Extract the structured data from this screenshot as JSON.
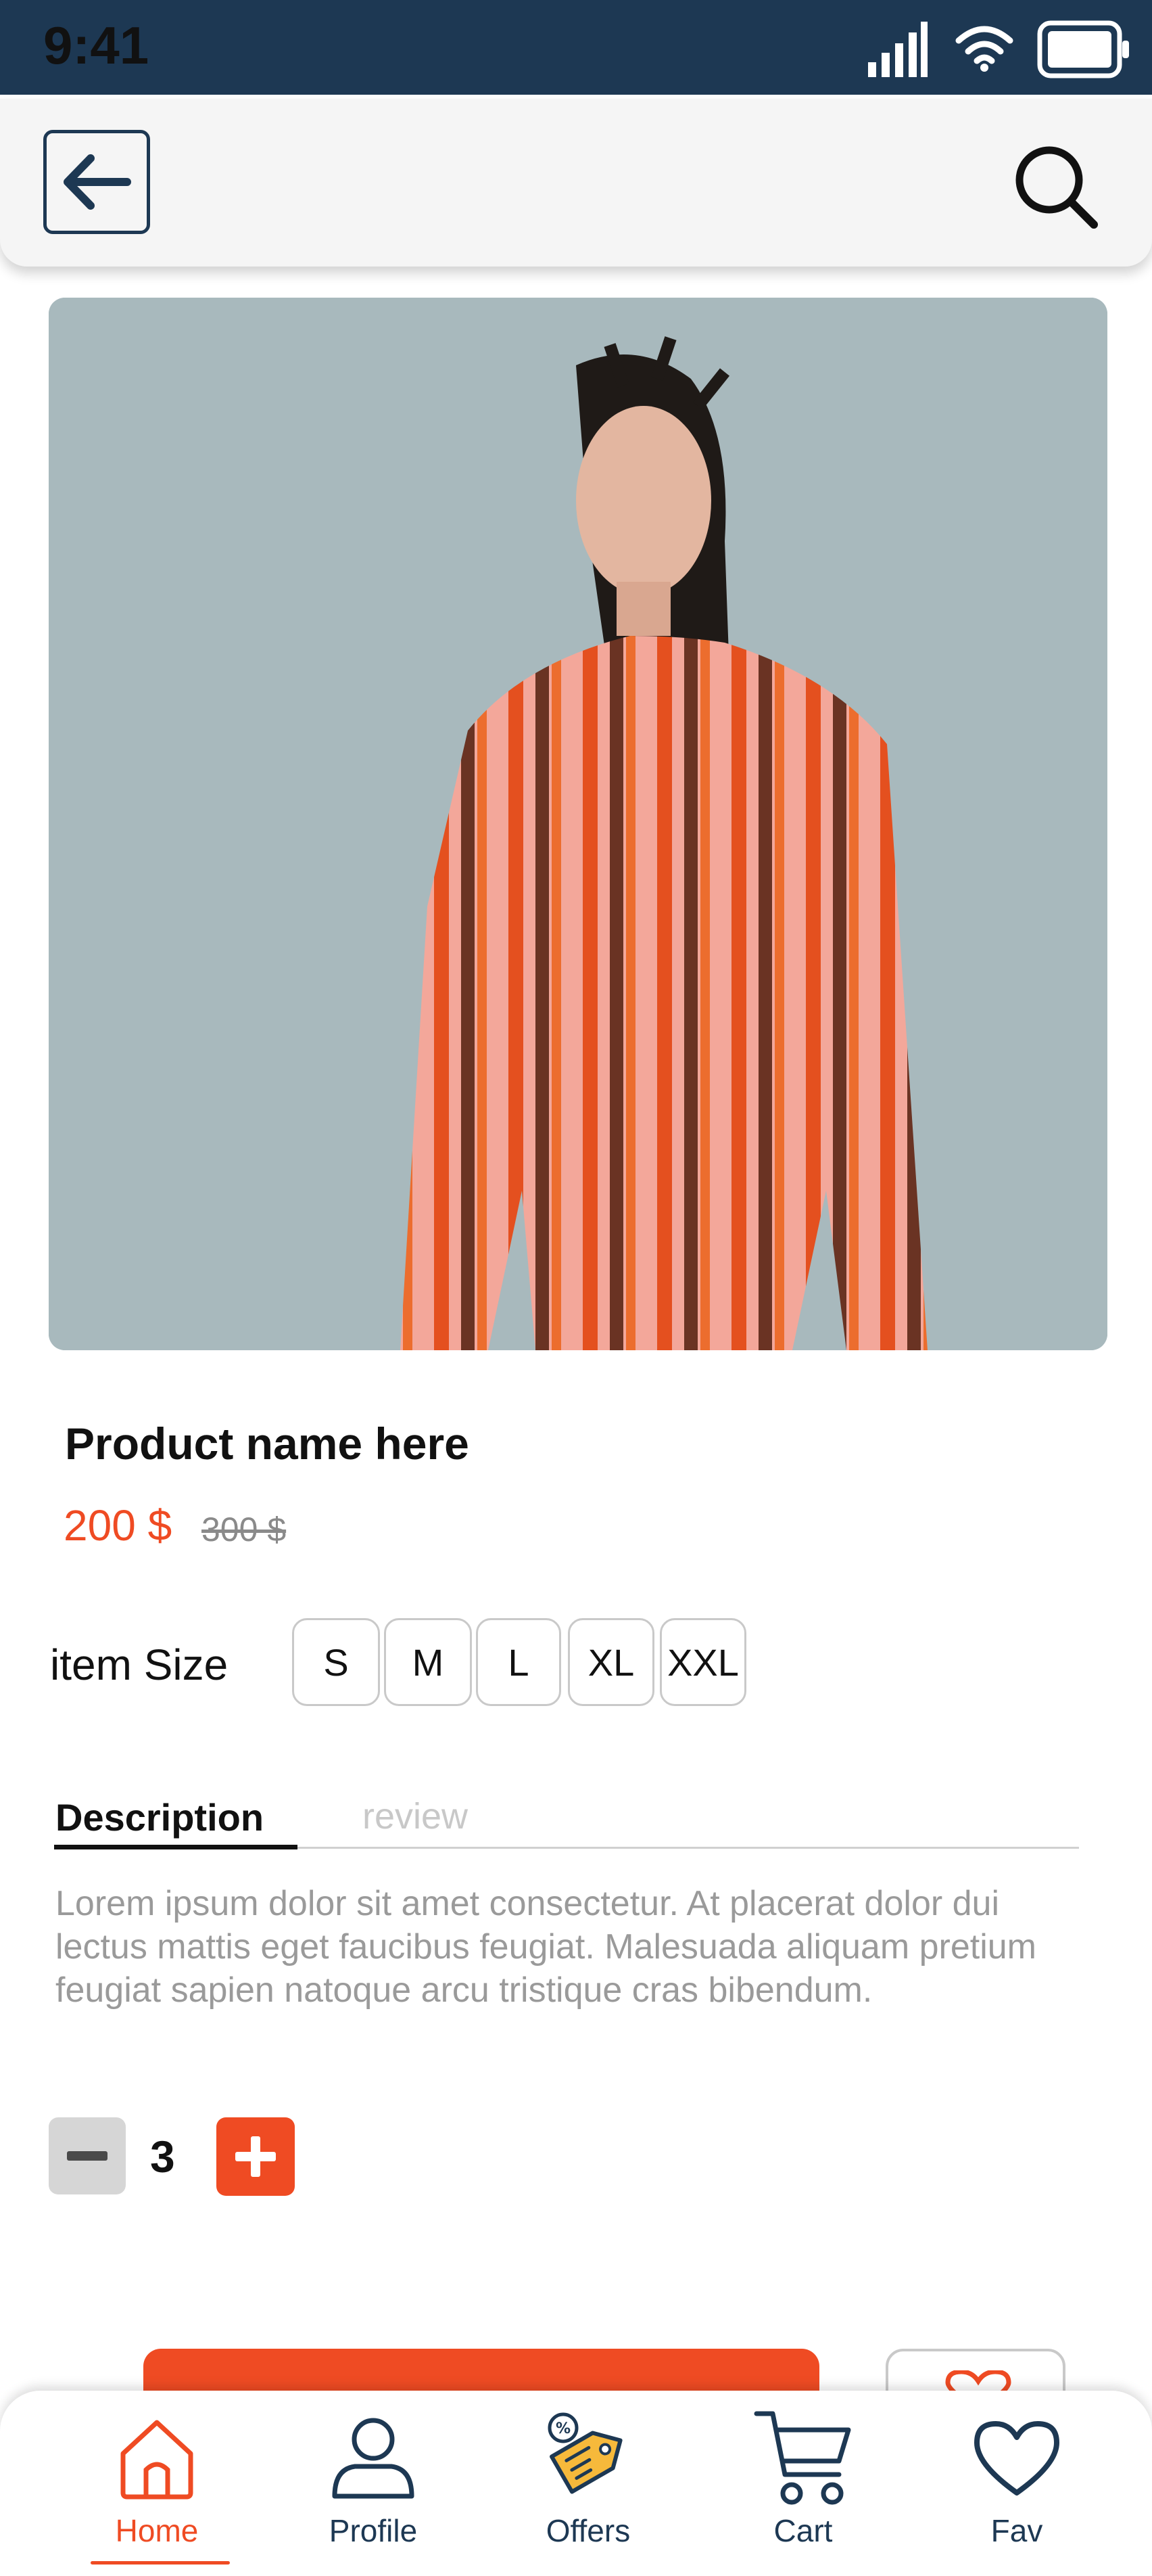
{
  "status_bar": {
    "time": "9:41"
  },
  "header": {
    "back_icon": "arrow-left-icon",
    "search_icon": "search-icon"
  },
  "product": {
    "name": "Product name here",
    "price": "200 $",
    "old_price": "300 $"
  },
  "sizes": {
    "label": "item Size",
    "options": [
      "S",
      "M",
      "L",
      "XL",
      "XXL"
    ]
  },
  "tabs": {
    "description": "Description",
    "review": "review",
    "active": "Description"
  },
  "description_text": "Lorem ipsum dolor sit amet consectetur. At placerat dolor dui lectus mattis eget faucibus feugiat. Malesuada aliquam pretium feugiat sapien natoque arcu tristique cras bibendum.",
  "quantity": {
    "value": "3"
  },
  "nav": {
    "items": [
      {
        "label": "Home",
        "icon": "home-icon",
        "active": true
      },
      {
        "label": "Profile",
        "icon": "user-icon",
        "active": false
      },
      {
        "label": "Offers",
        "icon": "discount-tag-icon",
        "active": false
      },
      {
        "label": "Cart",
        "icon": "cart-icon",
        "active": false
      },
      {
        "label": "Fav",
        "icon": "heart-icon",
        "active": false
      }
    ]
  },
  "colors": {
    "primary_dark": "#1d3853",
    "accent": "#ef4b23",
    "muted_text": "#9a9a9a"
  }
}
